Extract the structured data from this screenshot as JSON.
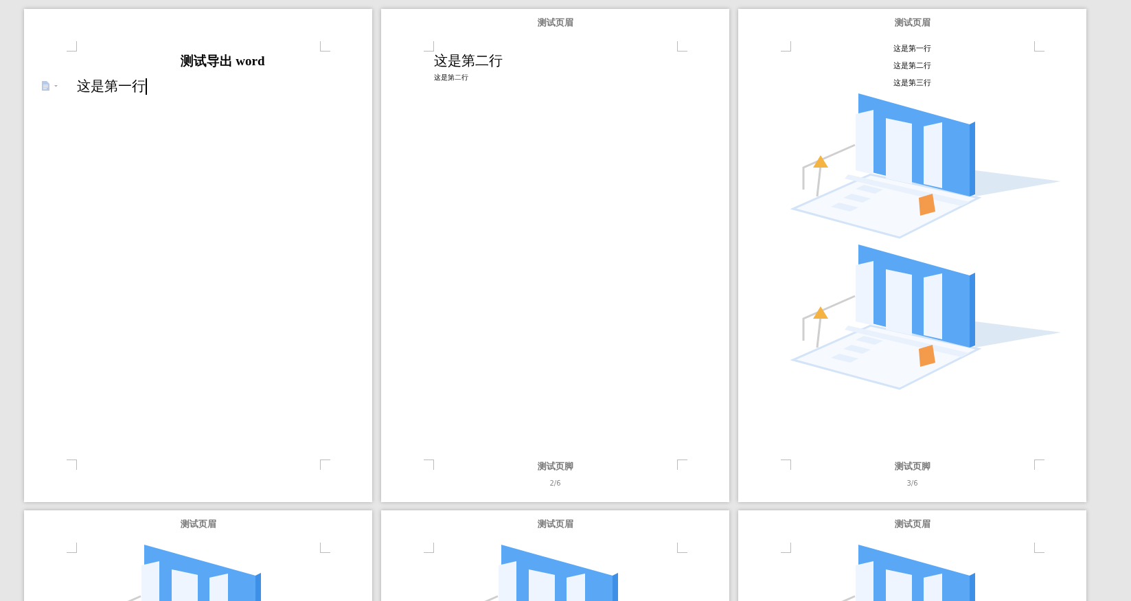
{
  "pages": [
    {
      "blocks": [
        {
          "kind": "title",
          "text": "测试导出 word"
        },
        {
          "kind": "paragraph",
          "text": "这是第一行",
          "marker": true,
          "caret": true
        }
      ]
    },
    {
      "header": "测试页眉",
      "blocks": [
        {
          "kind": "heading",
          "text": "这是第二行"
        },
        {
          "kind": "small",
          "text": "这是第二行"
        }
      ],
      "footer": "测试页脚",
      "page_number": "2/6"
    },
    {
      "header": "测试页眉",
      "blocks": [
        {
          "kind": "line",
          "text": "这是第一行"
        },
        {
          "kind": "line",
          "text": "这是第二行"
        },
        {
          "kind": "line",
          "text": "这是第三行"
        },
        {
          "kind": "picture"
        },
        {
          "kind": "picture"
        }
      ],
      "footer": "测试页脚",
      "page_number": "3/6"
    },
    {
      "header": "测试页眉",
      "blocks": [
        {
          "kind": "picture"
        }
      ]
    },
    {
      "header": "测试页眉",
      "blocks": [
        {
          "kind": "picture"
        }
      ]
    },
    {
      "header": "测试页眉",
      "blocks": [
        {
          "kind": "picture"
        }
      ]
    }
  ]
}
